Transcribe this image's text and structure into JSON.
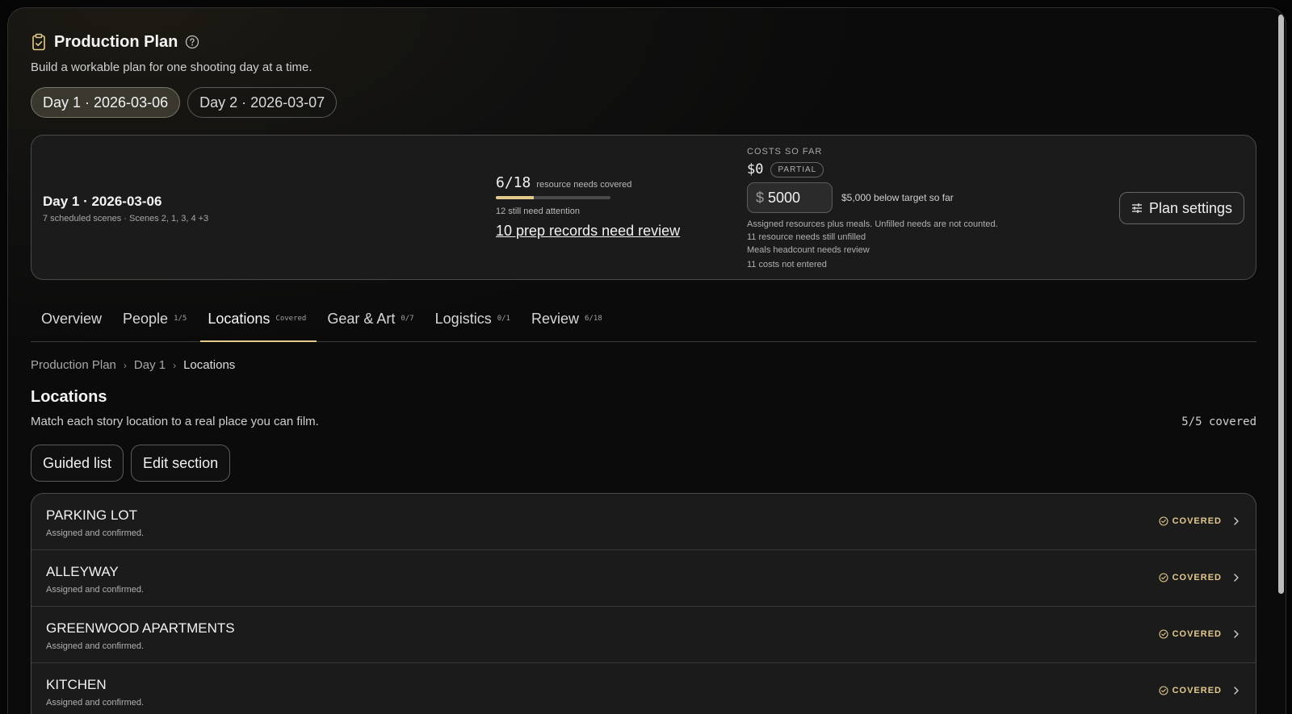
{
  "page": {
    "title": "Production Plan",
    "subtitle": "Build a workable plan for one shooting day at a time."
  },
  "day_tabs": [
    {
      "label": "Day 1 · 2026-03-06",
      "active": true
    },
    {
      "label": "Day 2 · 2026-03-07",
      "active": false
    }
  ],
  "summary": {
    "day_title": "Day 1 · 2026-03-06",
    "day_meta": "7 scheduled scenes · Scenes 2, 1, 3, 4 +3",
    "needs_covered": "6/18",
    "needs_label": "resource needs covered",
    "needs_progress": 0.333,
    "needs_attention": "12 still need attention",
    "review_link": "10 prep records need review",
    "costs_label": "COSTS SO FAR",
    "costs_amount": "$0",
    "costs_badge": "PARTIAL",
    "target_currency": "$",
    "target_value": "5000",
    "target_note": "$5,000 below target so far",
    "notes": [
      "Assigned resources plus meals. Unfilled needs are not counted.",
      "11 resource needs still unfilled",
      "Meals headcount needs review"
    ],
    "costs_not_entered": "11 costs not entered",
    "plan_settings_label": "Plan settings"
  },
  "section_tabs": [
    {
      "label": "Overview",
      "count": "",
      "active": false
    },
    {
      "label": "People",
      "count": "1/5",
      "active": false
    },
    {
      "label": "Locations",
      "count": "Covered",
      "active": true
    },
    {
      "label": "Gear & Art",
      "count": "0/7",
      "active": false
    },
    {
      "label": "Logistics",
      "count": "0/1",
      "active": false
    },
    {
      "label": "Review",
      "count": "6/18",
      "active": false
    }
  ],
  "breadcrumb": [
    "Production Plan",
    "Day 1",
    "Locations"
  ],
  "locations": {
    "title": "Locations",
    "description": "Match each story location to a real place you can film.",
    "summary": "5/5 covered",
    "guided_list_label": "Guided list",
    "edit_section_label": "Edit section",
    "items": [
      {
        "name": "PARKING LOT",
        "status": "Assigned and confirmed.",
        "badge": "COVERED"
      },
      {
        "name": "ALLEYWAY",
        "status": "Assigned and confirmed.",
        "badge": "COVERED"
      },
      {
        "name": "GREENWOOD APARTMENTS",
        "status": "Assigned and confirmed.",
        "badge": "COVERED"
      },
      {
        "name": "KITCHEN",
        "status": "Assigned and confirmed.",
        "badge": "COVERED"
      }
    ]
  },
  "colors": {
    "accent": "#e3c98c",
    "background": "#0b0b0b",
    "panel": "#1b1b1c"
  },
  "icons": [
    "clipboard-icon",
    "help-circle-icon",
    "sliders-icon",
    "chevron-right-icon",
    "check-circle-icon"
  ]
}
